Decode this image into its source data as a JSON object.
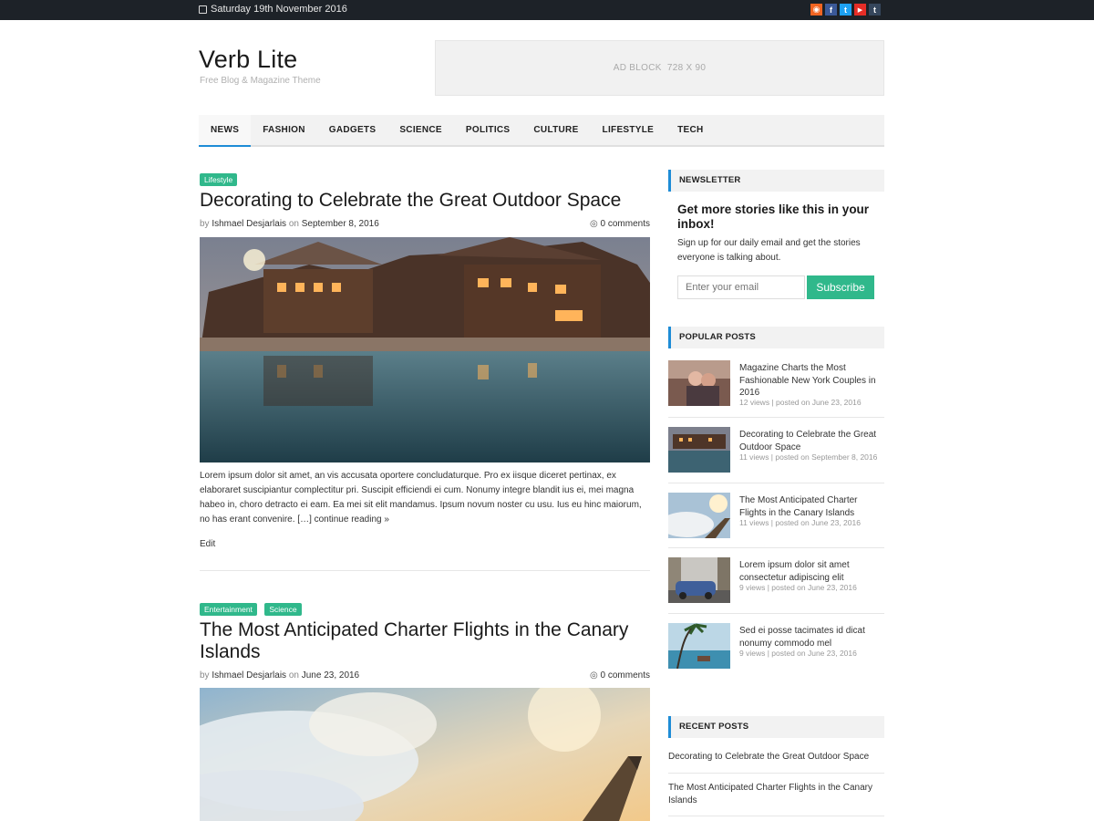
{
  "topbar": {
    "date": "Saturday 19th November 2016",
    "social": [
      {
        "icon": "rss-icon",
        "glyph": "◉",
        "color": "#f26522"
      },
      {
        "icon": "facebook-icon",
        "glyph": "f",
        "color": "#3b5998"
      },
      {
        "icon": "twitter-icon",
        "glyph": "t",
        "color": "#1da1f2"
      },
      {
        "icon": "youtube-icon",
        "glyph": "▶",
        "color": "#e52d27"
      },
      {
        "icon": "tumblr-icon",
        "glyph": "t",
        "color": "#35465c"
      }
    ]
  },
  "header": {
    "title": "Verb Lite",
    "tagline": "Free Blog & Magazine Theme",
    "ad": "AD BLOCK  728 X 90"
  },
  "nav": [
    "NEWS",
    "FASHION",
    "GADGETS",
    "SCIENCE",
    "POLITICS",
    "CULTURE",
    "LIFESTYLE",
    "TECH"
  ],
  "posts": [
    {
      "tags": [
        "Lifestyle"
      ],
      "title": "Decorating to Celebrate the Great Outdoor Space",
      "by": "by",
      "author": "Ishmael Desjarlais",
      "on": "on",
      "date": "September 8, 2016",
      "comments": "0 comments",
      "excerpt": "Lorem ipsum dolor sit amet, an vis accusata oportere concludaturque. Pro ex iisque diceret pertinax, ex elaboraret suscipiantur complectitur pri. Suscipit efficiendi ei cum. Nonumy integre blandit ius ei, mei magna habeo in, choro detracto ei eam. Ea mei sit elit mandamus. Ipsum novum noster cu usu. Ius eu hinc maiorum, no has erant convenire. […] continue reading »",
      "edit": "Edit"
    },
    {
      "tags": [
        "Entertainment",
        "Science"
      ],
      "title": "The Most Anticipated Charter Flights in the Canary Islands",
      "by": "by",
      "author": "Ishmael Desjarlais",
      "on": "on",
      "date": "June 23, 2016",
      "comments": "0 comments"
    }
  ],
  "sidebar": {
    "newsletter": {
      "title": "NEWSLETTER",
      "heading": "Get more stories like this in your inbox!",
      "text": "Sign up for our daily email and get the stories everyone is talking about.",
      "placeholder": "Enter your email",
      "button": "Subscribe"
    },
    "popular": {
      "title": "POPULAR POSTS",
      "items": [
        {
          "title": "Magazine Charts the Most Fashionable New York Couples in 2016",
          "meta": "12 views | posted on June 23, 2016"
        },
        {
          "title": "Decorating to Celebrate the Great Outdoor Space",
          "meta": "11 views | posted on September 8, 2016"
        },
        {
          "title": "The Most Anticipated Charter Flights in the Canary Islands",
          "meta": "11 views | posted on June 23, 2016"
        },
        {
          "title": "Lorem ipsum dolor sit amet consectetur adipiscing elit",
          "meta": "9 views | posted on June 23, 2016"
        },
        {
          "title": "Sed ei posse tacimates id dicat nonumy commodo mel",
          "meta": "9 views | posted on June 23, 2016"
        }
      ]
    },
    "recent": {
      "title": "RECENT POSTS",
      "items": [
        "Decorating to Celebrate the Great Outdoor Space",
        "The Most Anticipated Charter Flights in the Canary Islands"
      ]
    }
  },
  "colors": {
    "accent": "#1e8cd6",
    "tag": "#30b88b",
    "topbar": "#1d2228"
  }
}
